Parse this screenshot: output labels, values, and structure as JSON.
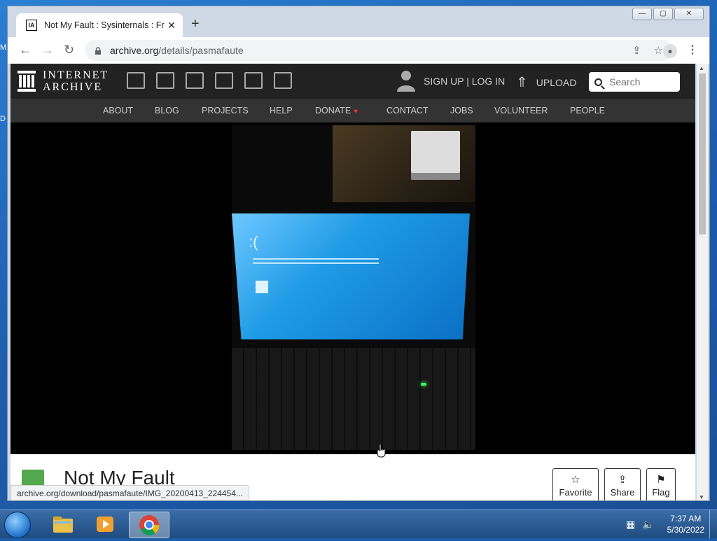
{
  "desktop": {
    "frag_top": "M",
    "frag_mid": "D"
  },
  "window": {
    "controls": {
      "minimize": "—",
      "maximize": "▢",
      "close": "✕"
    }
  },
  "tab": {
    "title": "Not My Fault : Sysinternals : Free",
    "favicon": "IA",
    "close": "✕",
    "new_tab": "+"
  },
  "toolbar": {
    "back": "←",
    "forward": "→",
    "reload": "↻",
    "url_host": "archive.org",
    "url_path": "/details/pasmafaute",
    "share": "⇪",
    "bookmark": "☆",
    "menu": "⋮"
  },
  "ia": {
    "logo_line1": "INTERNET",
    "logo_line2": "ARCHIVE",
    "media_icons": [
      "web-icon",
      "texts-icon",
      "video-icon",
      "audio-icon",
      "software-icon",
      "images-icon"
    ],
    "auth": "SIGN UP | LOG IN",
    "upload": "UPLOAD",
    "search_placeholder": "Search",
    "nav": [
      "ABOUT",
      "BLOG",
      "PROJECTS",
      "HELP",
      "DONATE",
      "CONTACT",
      "JOBS",
      "VOLUNTEER",
      "PEOPLE"
    ],
    "donate_heart": "♥"
  },
  "item": {
    "title": "Not My Fault",
    "actions": [
      {
        "label": "Favorite",
        "icon": "☆"
      },
      {
        "label": "Share",
        "icon": "⇪"
      },
      {
        "label": "Flag",
        "icon": "⚑"
      }
    ]
  },
  "status_url": "archive.org/download/pasmafaute/IMG_20200413_224454...",
  "taskbar": {
    "time": "7:37 AM",
    "date": "5/30/2022",
    "apps": [
      "file-explorer-icon",
      "media-player-icon",
      "chrome-icon"
    ]
  },
  "colors": {
    "ia_header": "#222222",
    "ia_nav": "#333333",
    "item_icon": "#52a84c",
    "taskbar": "#1f4b80"
  }
}
